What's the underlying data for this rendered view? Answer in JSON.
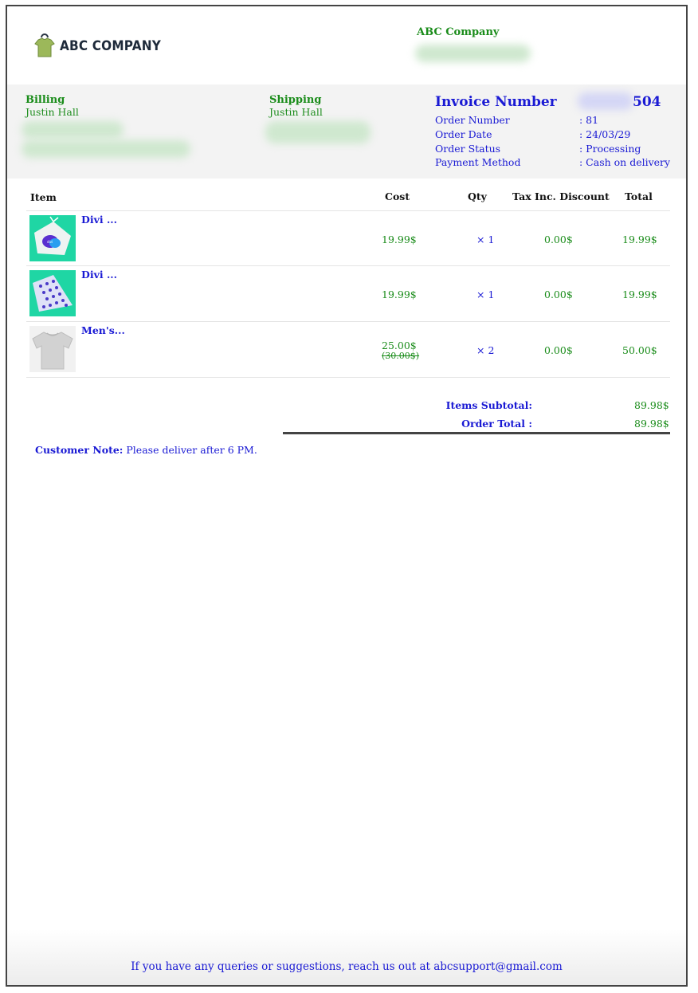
{
  "company": {
    "logo_text": "ABC COMPANY",
    "name": "ABC Company"
  },
  "billing": {
    "title": "Billing",
    "name": "Justin Hall"
  },
  "shipping": {
    "title": "Shipping",
    "name": "Justin Hall"
  },
  "invoice": {
    "title": "Invoice Number",
    "number_visible_tail": "504",
    "fields": [
      {
        "label": "Order Number",
        "value": ": 81"
      },
      {
        "label": "Order Date",
        "value": ": 24/03/29"
      },
      {
        "label": "Order Status",
        "value": ": Processing"
      },
      {
        "label": "Payment Method",
        "value": ": Cash on delivery"
      }
    ]
  },
  "table": {
    "headers": {
      "item": "Item",
      "cost": "Cost",
      "qty": "Qty",
      "discount": "Tax Inc. Discount",
      "total": "Total"
    },
    "rows": [
      {
        "name": "Divi ...",
        "cost": "19.99$",
        "original_cost": "",
        "qty": "× 1",
        "discount": "0.00$",
        "total": "19.99$"
      },
      {
        "name": "Divi ...",
        "cost": "19.99$",
        "original_cost": "",
        "qty": "× 1",
        "discount": "0.00$",
        "total": "19.99$"
      },
      {
        "name": "Men's...",
        "cost": "25.00$",
        "original_cost": "(30.00$)",
        "qty": "× 2",
        "discount": "0.00$",
        "total": "50.00$"
      }
    ]
  },
  "summary": {
    "subtotal_label": "Items Subtotal:",
    "subtotal_value": "89.98$",
    "total_label": "Order Total :",
    "total_value": "89.98$"
  },
  "note": {
    "label": "Customer Note:",
    "text": " Please deliver after 6 PM."
  },
  "footer": {
    "text": "If you have any queries or suggestions, reach us out at abcsupport@gmail.com"
  }
}
